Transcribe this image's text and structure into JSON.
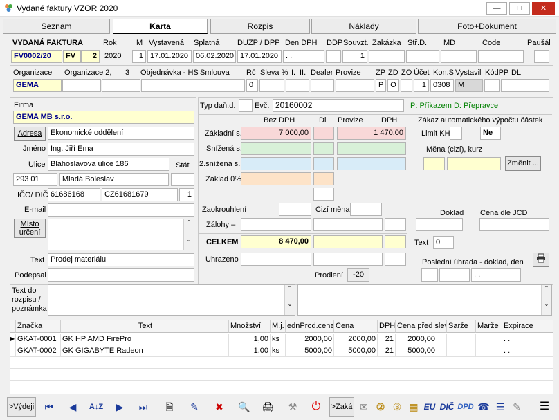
{
  "window": {
    "title": "Vydané faktury VZOR  2020"
  },
  "tabs": [
    "Seznam",
    "Karta",
    "Rozpis",
    "Náklady",
    "Foto+Dokument"
  ],
  "header": {
    "section_label": "VYDANÁ FAKTURA",
    "labels": [
      "Rok",
      "M",
      "Vystavená",
      "Splatná",
      "DUZP / DPP",
      "Den DPH",
      "DDP",
      "Souvzt.",
      "Zakázka",
      "Stř.D.",
      "MD",
      "Code",
      "Paušál"
    ],
    "number": "FV0002/20",
    "series": "FV",
    "series_num": "2",
    "year": "2020",
    "month": "1",
    "issued": "17.01.2020",
    "due": "06.02.2020",
    "duzp": "17.01.2020",
    "vat_day": ". .",
    "souvzt": "1"
  },
  "org": {
    "labels": [
      "Organizace",
      "Organizace 2,",
      "3",
      "Objednávka - HS",
      "Smlouva",
      "Rč",
      "Sleva %",
      "I.",
      "II.",
      "Dealer",
      "Provize",
      "ZP",
      "ZD",
      "ZO",
      "Účet",
      "Kon.S.",
      "Vystavil",
      "KódPP",
      "DL"
    ],
    "org_value": "GEMA",
    "rc": "0",
    "zp": "P",
    "zd": "O",
    "ucet": "1",
    "kon_s": "0308",
    "vystavil": "M"
  },
  "firma": {
    "label": "Firma",
    "name": "GEMA MB s.r.o.",
    "adresa_btn": "Adresa",
    "department": "Ekonomické oddělení",
    "jmeno_label": "Jméno",
    "jmeno": "Ing. Jiří Ema",
    "ulice_label": "Ulice",
    "ulice": "Blahoslavova ulice 186",
    "stat_label": "Stát",
    "psc": "293 01",
    "mesto": "Mladá Boleslav",
    "ico_label": "IČO/ DIČ",
    "ico": "61686168",
    "dic": "CZ61681679",
    "dic_num": "1",
    "email_label": "E-mail",
    "misto_btn_1": "Místo",
    "misto_btn_2": "určení",
    "text_label": "Text",
    "text": "Prodej materiálu",
    "podepsal_label": "Podepsal"
  },
  "tax": {
    "typ_label": "Typ daň.d.",
    "evc_label": "Evč.",
    "evc": "20160002",
    "payment_note": "P: Příkazem  D: Přepravce",
    "cols": [
      "Bez DPH",
      "Di",
      "Provize",
      "DPH"
    ],
    "rows": [
      "Základní s.",
      "Snížená s.",
      "2.snížená s.",
      "Základ 0%"
    ],
    "zakladni_bez": "7 000,00",
    "zakladni_dph": "1 470,00",
    "zakaz_label": "Zákaz automatického výpočtu částek",
    "limit_label": "Limit KH",
    "ne": "Ne",
    "mena_label": "Měna (cizí), kurz",
    "zmenit_btn": "Změnit ...",
    "zaokr_label": "Zaokrouhlení",
    "cizi_mena_label": "Cizí měna",
    "zalohy_label": "Zálohy  –",
    "celkem_label": "CELKEM",
    "celkem": "8 470,00",
    "uhrazeno_label": "Uhrazeno",
    "prodleni_label": "Prodlení",
    "prodleni": "-20",
    "doklad_label": "Doklad",
    "cena_jcd_label": "Cena dle JCD",
    "text_label": "Text",
    "text_val": "0",
    "posledni_label": "Poslední úhrada - doklad, den",
    "posledni_date": ". ."
  },
  "rozpis": {
    "label_1": "Text do",
    "label_2": "rozpisu /",
    "label_3": "poznámka"
  },
  "grid": {
    "cols": [
      "Značka",
      "Text",
      "Množství",
      "M.j.",
      "ednProd.cena",
      "Cena",
      "DPH",
      "Cena před slev",
      "Sarže",
      "Marže",
      "Expirace"
    ],
    "rows": [
      {
        "znacka": "GKAT-0001",
        "text": "GK HP AMD FirePro",
        "mnozstvi": "1,00",
        "mj": "ks",
        "prod_cena": "2000,00",
        "cena": "2000,00",
        "dph": "21",
        "pred_slev": "2000,00",
        "expirace": ". ."
      },
      {
        "znacka": "GKAT-0002",
        "text": "GK  GIGABYTE Radeon",
        "mnozstvi": "1,00",
        "mj": "ks",
        "prod_cena": "5000,00",
        "cena": "5000,00",
        "dph": "21",
        "pred_slev": "5000,00",
        "expirace": ". ."
      }
    ]
  },
  "toolbar": {
    "vydej": ">Výdeji",
    "zaka": ">Zaká",
    "eu": "EU",
    "dic": "DIČ",
    "dpd": "DPD"
  }
}
